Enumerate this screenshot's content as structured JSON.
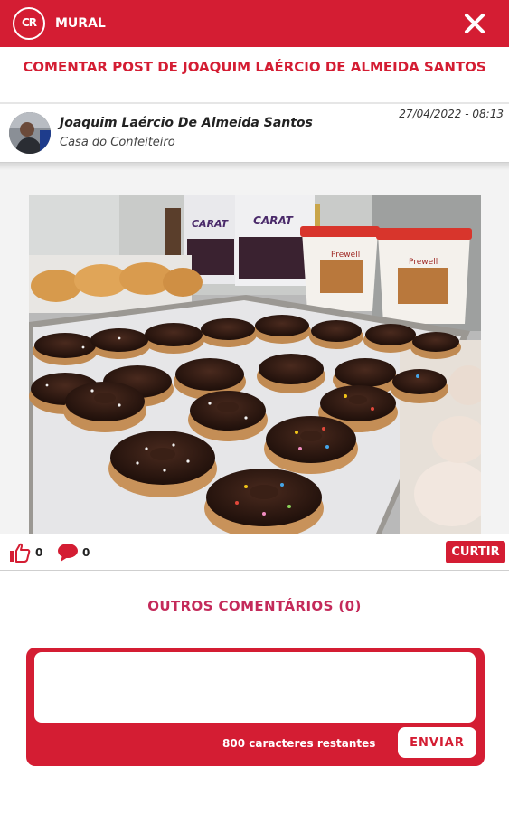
{
  "header": {
    "logo_text": "CR",
    "title": "MURAL",
    "close_icon": "close-icon"
  },
  "post": {
    "heading": "COMENTAR POST DE JOAQUIM LAÉRCIO DE ALMEIDA SANTOS",
    "author_name": "Joaquim Laércio De Almeida Santos",
    "author_place": "Casa do Confeiteiro",
    "date": "27/04/2022 - 08:13",
    "photo_text": {
      "bag1_brand": "CARAT",
      "bag2_brand": "CARAT",
      "bucket1_brand": "Prewell",
      "bucket2_brand": "Prewell"
    }
  },
  "actions": {
    "like_icon": "thumbs-up-icon",
    "likes": "0",
    "comment_icon": "speech-bubble-icon",
    "comments": "0",
    "like_button_label": "CURTIR"
  },
  "other_comments_label": "OUTROS COMENTÁRIOS (0)",
  "comment_form": {
    "value": "",
    "placeholder": "",
    "remaining_label": "800 caracteres restantes",
    "send_label": "ENVIAR"
  },
  "colors": {
    "brand_red": "#d41d33",
    "section_pink": "#c42a5a"
  }
}
